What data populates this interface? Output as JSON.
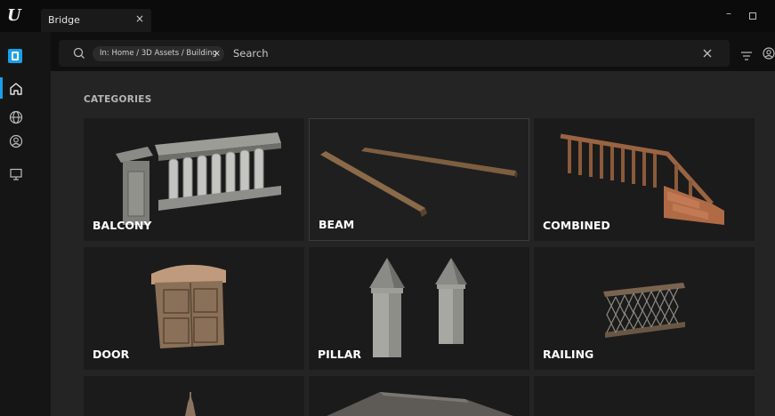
{
  "window": {
    "tab_title": "Bridge",
    "tab_close": "×",
    "minimize": "–"
  },
  "search": {
    "breadcrumb_chip": "In: Home / 3D Assets / Building",
    "chip_close": "×",
    "placeholder": "Search"
  },
  "sidebar": {
    "items": [
      {
        "name": "home",
        "active": true
      },
      {
        "name": "globe"
      },
      {
        "name": "account"
      },
      {
        "name": "monitor"
      }
    ]
  },
  "main": {
    "section_title": "CATEGORIES",
    "categories": [
      {
        "label": "BALCONY"
      },
      {
        "label": "BEAM"
      },
      {
        "label": "COMBINED"
      },
      {
        "label": "DOOR"
      },
      {
        "label": "PILLAR"
      },
      {
        "label": "RAILING"
      }
    ]
  },
  "colors": {
    "accent": "#1aa0e6",
    "background": "#242424",
    "card": "#1b1b1b"
  }
}
